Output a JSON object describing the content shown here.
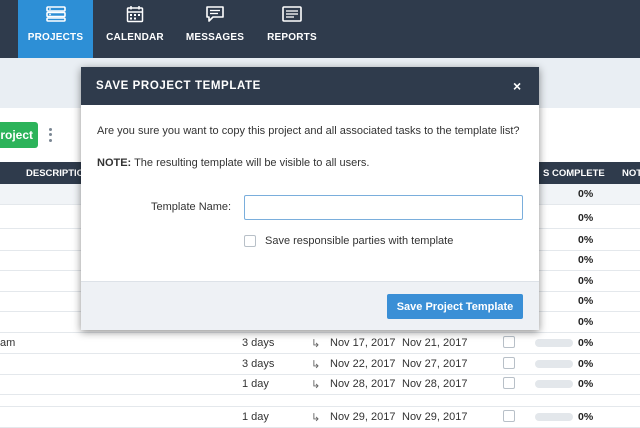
{
  "nav": {
    "items": [
      {
        "label": "PROJECTS",
        "icon": "server-icon",
        "active": true
      },
      {
        "label": "CALENDAR",
        "icon": "calendar-icon",
        "active": false
      },
      {
        "label": "MESSAGES",
        "icon": "chat-icon",
        "active": false
      },
      {
        "label": "REPORTS",
        "icon": "report-icon",
        "active": false
      }
    ]
  },
  "toolbar": {
    "green_button_label": "roject"
  },
  "table": {
    "headers": {
      "description": "DESCRIPTIO",
      "complete": "S COMPLETE",
      "notes": "NOT"
    },
    "rows": [
      {
        "description": "",
        "duration": "",
        "start": "",
        "end": "",
        "percent": "0%"
      },
      {
        "description": "",
        "duration": "",
        "start": "",
        "end": "",
        "percent": "0%"
      },
      {
        "description": "",
        "duration": "",
        "start": "",
        "end": "",
        "percent": "0%"
      },
      {
        "description": "",
        "duration": "",
        "start": "",
        "end": "",
        "percent": "0%"
      },
      {
        "description": "",
        "duration": "",
        "start": "",
        "end": "",
        "percent": "0%"
      },
      {
        "description": "",
        "duration": "",
        "start": "",
        "end": "",
        "percent": "0%"
      },
      {
        "description": "",
        "duration": "",
        "start": "",
        "end": "",
        "percent": "0%"
      },
      {
        "description": "am",
        "duration": "3 days",
        "start": "Nov 17, 2017",
        "end": "Nov 21, 2017",
        "percent": "0%"
      },
      {
        "description": "",
        "duration": "3 days",
        "start": "Nov 22, 2017",
        "end": "Nov 27, 2017",
        "percent": "0%"
      },
      {
        "description": "",
        "duration": "1 day",
        "start": "Nov 28, 2017",
        "end": "Nov 28, 2017",
        "percent": "0%"
      },
      {
        "description": "",
        "duration": "",
        "start": "",
        "end": "",
        "percent": ""
      },
      {
        "description": "",
        "duration": "1 day",
        "start": "Nov 29, 2017",
        "end": "Nov 29, 2017",
        "percent": "0%"
      }
    ]
  },
  "modal": {
    "title": "SAVE PROJECT TEMPLATE",
    "close": "×",
    "message": "Are you sure you want to copy this project and all associated tasks to the template list?",
    "note_label": "NOTE:",
    "note_text": " The resulting template will be visible to all users.",
    "field_label": "Template Name:",
    "field_value": "",
    "checkbox_label": "Save responsible parties with template",
    "primary_button": "Save Project Template"
  }
}
